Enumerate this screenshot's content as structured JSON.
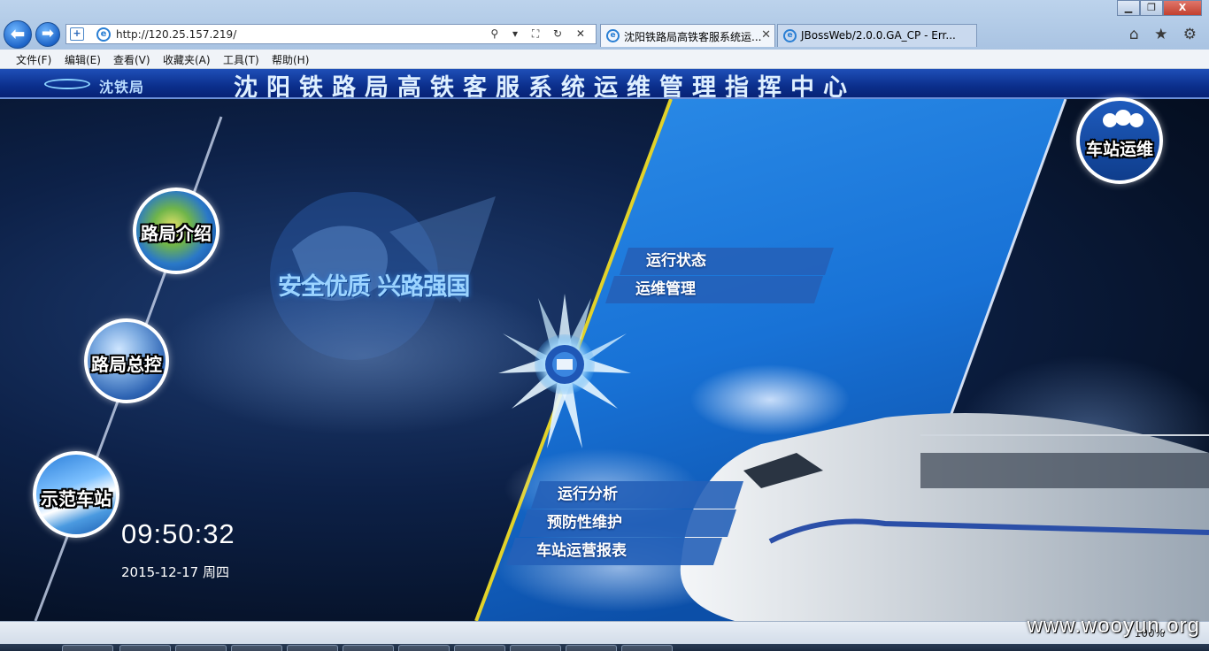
{
  "browser": {
    "url": "http://120.25.157.219/",
    "tabs": [
      {
        "label": "沈阳铁路局高铁客服系统运..."
      },
      {
        "label": "JBossWeb/2.0.0.GA_CP - Err..."
      }
    ],
    "menu": [
      "文件(F)",
      "编辑(E)",
      "查看(V)",
      "收藏夹(A)",
      "工具(T)",
      "帮助(H)"
    ],
    "zoom": "100%",
    "window_controls": {
      "minimize": "▁",
      "maximize": "❐",
      "close": "X"
    },
    "right_icons": "⌂ ★ ⚙",
    "address_tools": "⚲ ▾ ⛶ ↻ ✕"
  },
  "banner": {
    "logo_text": "沈铁局",
    "title": "沈阳铁路局高铁客服系统运维管理指挥中心"
  },
  "page": {
    "slogan": "安全优质  兴路强国",
    "nav_circles": {
      "ljjs": "路局介绍",
      "ljzk": "路局总控",
      "sfcz": "示范车站",
      "czyw": "车站运维"
    },
    "menu_top": [
      "运行状态",
      "运维管理"
    ],
    "menu_bottom": [
      "运行分析",
      "预防性维护",
      "车站运营报表"
    ],
    "clock": "09:50:32",
    "date": "2015-12-17 周四"
  },
  "watermark": "www.wooyun.org",
  "colors": {
    "banner_blue": "#0b2f8c",
    "menu_bar_blue": "#2560b8",
    "panel_blue": "#1c7fe0",
    "accent_yellow": "#d8c21a"
  }
}
